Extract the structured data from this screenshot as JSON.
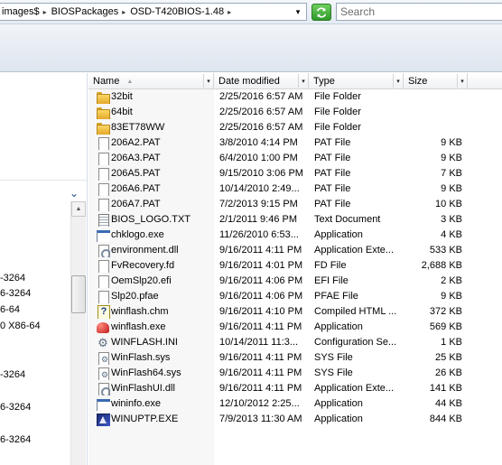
{
  "address": {
    "crumbs": [
      "images$",
      "BIOSPackages",
      "OSD-T420BIOS-1.48"
    ],
    "separator": "▸",
    "dropdown": "▾"
  },
  "search": {
    "placeholder": "Search"
  },
  "nav": {
    "chevron": "⌄",
    "items": [
      "-3264",
      "6-3264",
      "6-64",
      "0 X86-64",
      "-3264",
      "6-3264",
      "6-3264"
    ]
  },
  "columns": {
    "name": "Name",
    "date": "Date modified",
    "type": "Type",
    "size": "Size",
    "sort_arrow": "▲",
    "dropdown": "▾"
  },
  "files": [
    {
      "icon": "folder-icon",
      "name": "32bit",
      "date": "2/25/2016 6:57 AM",
      "type": "File Folder",
      "size": ""
    },
    {
      "icon": "folder-icon",
      "name": "64bit",
      "date": "2/25/2016 6:57 AM",
      "type": "File Folder",
      "size": ""
    },
    {
      "icon": "folder-icon",
      "name": "83ET78WW",
      "date": "2/25/2016 6:57 AM",
      "type": "File Folder",
      "size": ""
    },
    {
      "icon": "file-icon",
      "name": "206A2.PAT",
      "date": "3/8/2010 4:14 PM",
      "type": "PAT File",
      "size": "9 KB"
    },
    {
      "icon": "file-icon",
      "name": "206A3.PAT",
      "date": "6/4/2010 1:00 PM",
      "type": "PAT File",
      "size": "9 KB"
    },
    {
      "icon": "file-icon",
      "name": "206A5.PAT",
      "date": "9/15/2010 3:06 PM",
      "type": "PAT File",
      "size": "7 KB"
    },
    {
      "icon": "file-icon",
      "name": "206A6.PAT",
      "date": "10/14/2010 2:49...",
      "type": "PAT File",
      "size": "9 KB"
    },
    {
      "icon": "file-icon",
      "name": "206A7.PAT",
      "date": "7/2/2013 9:15 PM",
      "type": "PAT File",
      "size": "10 KB"
    },
    {
      "icon": "text-file-icon",
      "name": "BIOS_LOGO.TXT",
      "date": "2/1/2011 9:46 PM",
      "type": "Text Document",
      "size": "3 KB"
    },
    {
      "icon": "application-icon",
      "name": "chklogo.exe",
      "date": "11/26/2010 6:53...",
      "type": "Application",
      "size": "4 KB"
    },
    {
      "icon": "dll-icon",
      "name": "environment.dll",
      "date": "9/16/2011 4:11 PM",
      "type": "Application Exte...",
      "size": "533 KB"
    },
    {
      "icon": "file-icon",
      "name": "FvRecovery.fd",
      "date": "9/16/2011 4:01 PM",
      "type": "FD File",
      "size": "2,688 KB"
    },
    {
      "icon": "file-icon",
      "name": "OemSlp20.efi",
      "date": "9/16/2011 4:06 PM",
      "type": "EFI File",
      "size": "2 KB"
    },
    {
      "icon": "file-icon",
      "name": "Slp20.pfae",
      "date": "9/16/2011 4:06 PM",
      "type": "PFAE File",
      "size": "9 KB"
    },
    {
      "icon": "help-file-icon",
      "name": "winflash.chm",
      "date": "9/16/2011 4:10 PM",
      "type": "Compiled HTML ...",
      "size": "372 KB"
    },
    {
      "icon": "winflash-app-icon",
      "name": "winflash.exe",
      "date": "9/16/2011 4:11 PM",
      "type": "Application",
      "size": "569 KB"
    },
    {
      "icon": "settings-file-icon",
      "name": "WINFLASH.INI",
      "date": "10/14/2011 11:3...",
      "type": "Configuration Se...",
      "size": "1 KB"
    },
    {
      "icon": "system-file-icon",
      "name": "WinFlash.sys",
      "date": "9/16/2011 4:11 PM",
      "type": "SYS File",
      "size": "25 KB"
    },
    {
      "icon": "system-file-icon",
      "name": "WinFlash64.sys",
      "date": "9/16/2011 4:11 PM",
      "type": "SYS File",
      "size": "26 KB"
    },
    {
      "icon": "dll-icon",
      "name": "WinFlashUI.dll",
      "date": "9/16/2011 4:11 PM",
      "type": "Application Exte...",
      "size": "141 KB"
    },
    {
      "icon": "application-icon",
      "name": "wininfo.exe",
      "date": "12/10/2012 2:25...",
      "type": "Application",
      "size": "44 KB"
    },
    {
      "icon": "winuptp-app-icon",
      "name": "WINUPTP.EXE",
      "date": "7/9/2013 11:30 AM",
      "type": "Application",
      "size": "844 KB"
    }
  ]
}
